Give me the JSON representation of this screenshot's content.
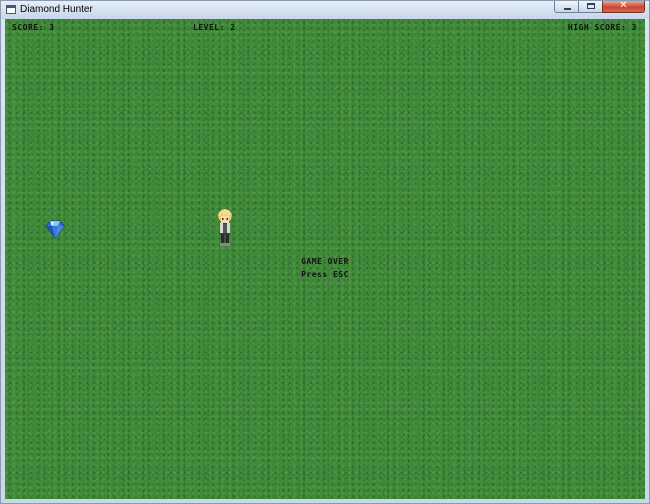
{
  "window": {
    "title": "Diamond Hunter",
    "close_glyph": "✕"
  },
  "hud": {
    "score": "SCORE: 3",
    "level": "LEVEL: 2",
    "high_score": "HIGH SCORE: 3"
  },
  "message": {
    "line1": "GAME OVER",
    "line2": "Press ESC"
  },
  "sprites": {
    "diamond_icon": "diamond-icon",
    "player_icon": "player-character-icon"
  },
  "colors": {
    "grass": "#3f8a3a",
    "text": "#111111",
    "diamond": "#2d6fd6"
  }
}
